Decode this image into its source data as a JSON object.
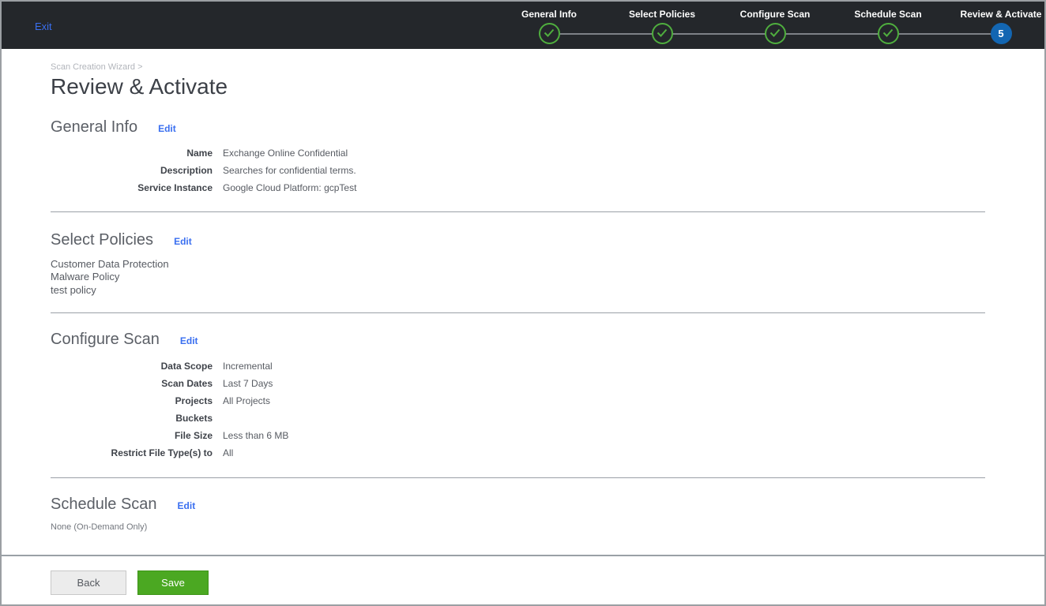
{
  "colors": {
    "header_bg": "#24272b",
    "accent_green": "#4ba822",
    "check_green": "#4fae3e",
    "current_step_blue": "#1366b2",
    "link_blue": "#3a6ff0"
  },
  "header": {
    "exit_label": "Exit",
    "steps": [
      {
        "label": "General Info",
        "state": "complete"
      },
      {
        "label": "Select Policies",
        "state": "complete"
      },
      {
        "label": "Configure Scan",
        "state": "complete"
      },
      {
        "label": "Schedule Scan",
        "state": "complete"
      },
      {
        "label": "Review & Activate",
        "state": "current",
        "number": "5"
      }
    ]
  },
  "breadcrumb": {
    "text": "Scan Creation Wizard",
    "separator": ">"
  },
  "page_title": "Review & Activate",
  "sections": {
    "general_info": {
      "title": "General Info",
      "edit_label": "Edit",
      "fields": [
        {
          "label": "Name",
          "value": "Exchange Online Confidential"
        },
        {
          "label": "Description",
          "value": "Searches for confidential terms."
        },
        {
          "label": "Service Instance",
          "value": "Google Cloud Platform: gcpTest"
        }
      ]
    },
    "select_policies": {
      "title": "Select Policies",
      "edit_label": "Edit",
      "policies": [
        "Customer Data Protection",
        "Malware Policy",
        "test policy"
      ]
    },
    "configure_scan": {
      "title": "Configure Scan",
      "edit_label": "Edit",
      "fields": [
        {
          "label": "Data Scope",
          "value": "Incremental"
        },
        {
          "label": "Scan Dates",
          "value": "Last 7 Days"
        },
        {
          "label": "Projects",
          "value": "All Projects"
        },
        {
          "label": "Buckets",
          "value": ""
        },
        {
          "label": "File Size",
          "value": "Less than 6 MB"
        },
        {
          "label": "Restrict File Type(s) to",
          "value": "All"
        }
      ]
    },
    "schedule_scan": {
      "title": "Schedule Scan",
      "edit_label": "Edit",
      "value": "None (On-Demand Only)"
    }
  },
  "footer": {
    "back_label": "Back",
    "save_label": "Save"
  }
}
